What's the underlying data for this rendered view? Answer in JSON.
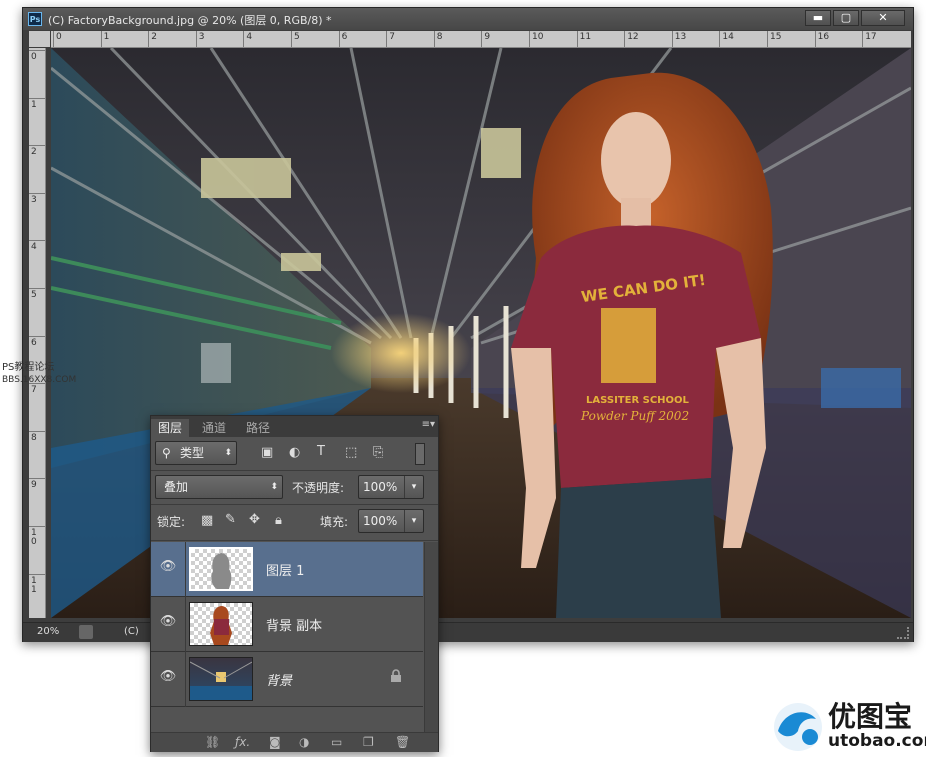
{
  "window": {
    "title": "(C) FactoryBackground.jpg @ 20% (图层 0, RGB/8) *",
    "app_logo": "Ps",
    "buttons": {
      "minimize": "▬",
      "maximize": "▢",
      "close": "✕"
    }
  },
  "rulers": {
    "horizontal_labels": [
      "0",
      "1",
      "2",
      "3",
      "4",
      "5",
      "6",
      "7",
      "8",
      "9",
      "10",
      "11",
      "12",
      "13",
      "14",
      "15",
      "16",
      "17"
    ],
    "vertical_labels": [
      "0",
      "1",
      "2",
      "3",
      "4",
      "5",
      "6",
      "7",
      "8",
      "9",
      "10",
      "11"
    ]
  },
  "status": {
    "zoom": "20%",
    "doc": "(C)"
  },
  "watermark_left": {
    "line1": "PS教程论坛",
    "line2": "BBS.16XX8.COM"
  },
  "shirt": {
    "line1": "WE CAN DO IT!",
    "line2": "LASSITER SCHOOL",
    "line3": "Powder Puff 2002"
  },
  "layers_panel": {
    "tabs": [
      "图层",
      "通道",
      "路径"
    ],
    "filter": {
      "label": "类型"
    },
    "blend_mode": "叠加",
    "opacity": {
      "label": "不透明度:",
      "value": "100%"
    },
    "lock": {
      "label": "锁定:"
    },
    "fill": {
      "label": "填充:",
      "value": "100%"
    },
    "layers": [
      {
        "name": "图层 1",
        "selected": true
      },
      {
        "name": "背景 副本",
        "selected": false
      },
      {
        "name": "背景",
        "selected": false,
        "locked": true
      }
    ]
  },
  "brand": {
    "name": "优图宝",
    "url": "utobao.com"
  },
  "colors": {
    "selected_layer": "#586f8e",
    "panel_bg": "#535353",
    "shirt": "#8b2a3d",
    "hair": "#a8491e"
  }
}
